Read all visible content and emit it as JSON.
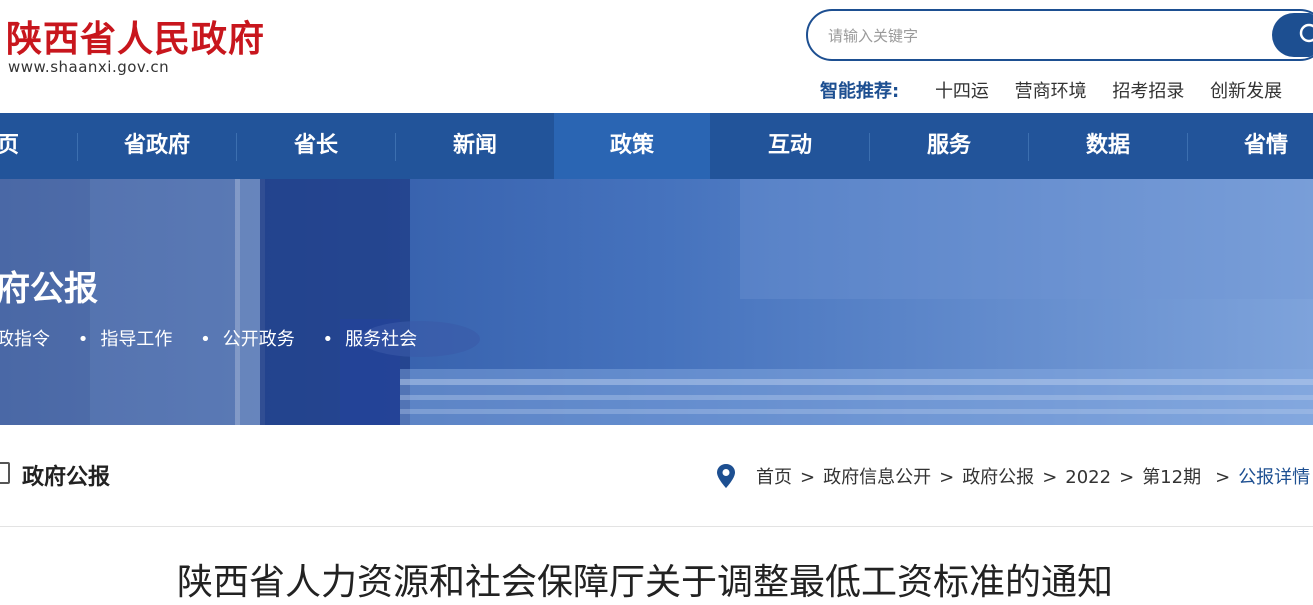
{
  "header": {
    "logo_title": "陕西省人民政府",
    "logo_url": "www.shaanxi.gov.cn",
    "search": {
      "placeholder": "请输入关键字"
    },
    "recommend": {
      "label": "智能推荐:",
      "items": [
        "十四运",
        "营商环境",
        "招考招录",
        "创新发展"
      ]
    }
  },
  "nav": {
    "items": [
      {
        "label": "页"
      },
      {
        "label": "省政府"
      },
      {
        "label": "省长"
      },
      {
        "label": "新闻"
      },
      {
        "label": "政策"
      },
      {
        "label": "互动"
      },
      {
        "label": "服务"
      },
      {
        "label": "数据"
      },
      {
        "label": "省情"
      }
    ],
    "active_label": "政策"
  },
  "banner": {
    "title": "府公报",
    "links": [
      "政指令",
      "指导工作",
      "公开政务",
      "服务社会"
    ]
  },
  "section": {
    "title": "政府公报"
  },
  "breadcrumb": {
    "items": [
      "首页",
      "政府信息公开",
      "政府公报",
      "2022",
      "第12期",
      "公报详情"
    ],
    "separator": ">"
  },
  "article": {
    "title": "陕西省人力资源和社会保障厅关于调整最低工资标准的通知"
  },
  "colors": {
    "brand_red": "#c8161d",
    "nav_blue": "#22549a",
    "accent_blue": "#1d4f91"
  }
}
